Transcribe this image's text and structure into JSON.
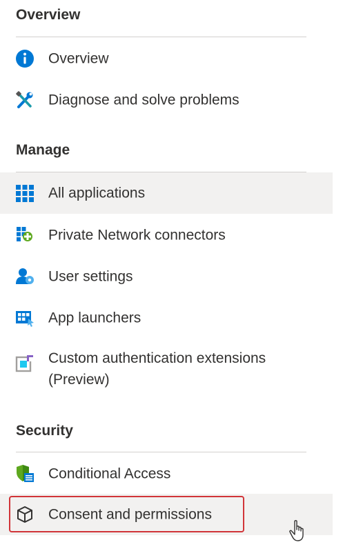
{
  "sections": {
    "overview": {
      "title": "Overview"
    },
    "manage": {
      "title": "Manage"
    },
    "security": {
      "title": "Security"
    }
  },
  "items": {
    "overview": {
      "label": "Overview",
      "icon": "info-icon"
    },
    "diagnose": {
      "label": "Diagnose and solve problems",
      "icon": "wrench-screwdriver-icon"
    },
    "all_applications": {
      "label": "All applications",
      "icon": "app-grid-icon",
      "selected": true
    },
    "private_network": {
      "label": "Private Network connectors",
      "icon": "network-connector-icon"
    },
    "user_settings": {
      "label": "User settings",
      "icon": "user-gear-icon"
    },
    "app_launchers": {
      "label": "App launchers",
      "icon": "app-launcher-icon"
    },
    "custom_auth": {
      "label": "Custom authentication extensions (Preview)",
      "icon": "custom-extension-icon"
    },
    "conditional_access": {
      "label": "Conditional Access",
      "icon": "shield-policy-icon"
    },
    "consent": {
      "label": "Consent and permissions",
      "icon": "cube-icon",
      "hovered": true
    }
  },
  "colors": {
    "accent": "#0078d4",
    "selected_bg": "#f2f1f0",
    "highlight_border": "#d13438",
    "divider": "#d2d0ce",
    "text": "#323130"
  }
}
